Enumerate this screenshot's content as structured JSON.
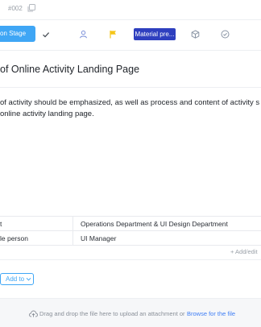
{
  "header": {
    "task_id": "#002"
  },
  "toolbar": {
    "stage_label": "on Stage",
    "tag_label": "Material pre..."
  },
  "task": {
    "title": "of Online Activity Landing Page",
    "description_lines": [
      "of activity should be emphasized, as well as process and content of activity s",
      "online activity landing page."
    ]
  },
  "fields": {
    "rows": [
      {
        "name": "t",
        "value": "Operations Department & UI Design Department"
      },
      {
        "name": "le person",
        "value": "UI Manager"
      }
    ],
    "add_edit_label": "+ Add/edit"
  },
  "add_to": {
    "label": "Add to"
  },
  "upload": {
    "instruction": "Drag and drop the file here to upload an attachment or",
    "browse_label": "Browse for the file"
  },
  "colors": {
    "accent": "#3fa6f5",
    "tag": "#2e3fbf",
    "flag": "#f5c518",
    "link": "#3f7ef5"
  }
}
